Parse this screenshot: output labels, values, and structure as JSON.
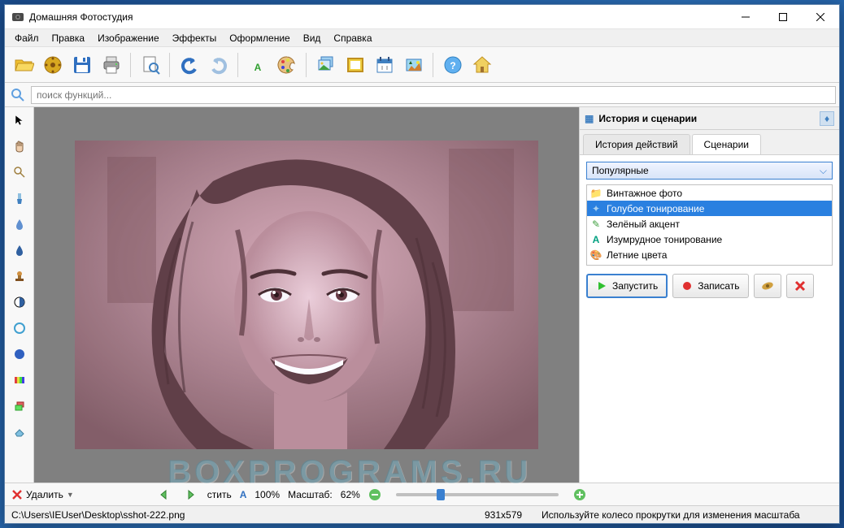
{
  "titlebar": {
    "text": "Домашняя Фотостудия"
  },
  "menubar": [
    "Файл",
    "Правка",
    "Изображение",
    "Эффекты",
    "Оформление",
    "Вид",
    "Справка"
  ],
  "search": {
    "placeholder": "поиск функций..."
  },
  "right_panel": {
    "title": "История и сценарии",
    "tabs": [
      "История действий",
      "Сценарии"
    ],
    "active_tab": 1,
    "dropdown": "Популярные",
    "scenarios": [
      {
        "label": "Винтажное фото",
        "icon": "folder",
        "color": "#e8a030"
      },
      {
        "label": "Голубое тонирование",
        "icon": "wand",
        "color": "#6ab0e0",
        "selected": true
      },
      {
        "label": "Зелёный акцент",
        "icon": "pencil",
        "color": "#40a040"
      },
      {
        "label": "Изумрудное тонирование",
        "icon": "letter",
        "color": "#00a080"
      },
      {
        "label": "Летние цвета",
        "icon": "palette",
        "color": "#d08030"
      }
    ],
    "buttons": {
      "run": "Запустить",
      "record": "Записать"
    }
  },
  "bottom": {
    "delete": "Удалить",
    "fit": "стить",
    "scale_letter": "А",
    "scale_100": "100%",
    "scale_label": "Масштаб:",
    "scale_value": "62%"
  },
  "status": {
    "path": "C:\\Users\\IEUser\\Desktop\\sshot-222.png",
    "dims": "931x579",
    "hint": "Используйте колесо прокрутки для изменения масштаба"
  },
  "watermark": "BOXPROGRAMS.RU"
}
